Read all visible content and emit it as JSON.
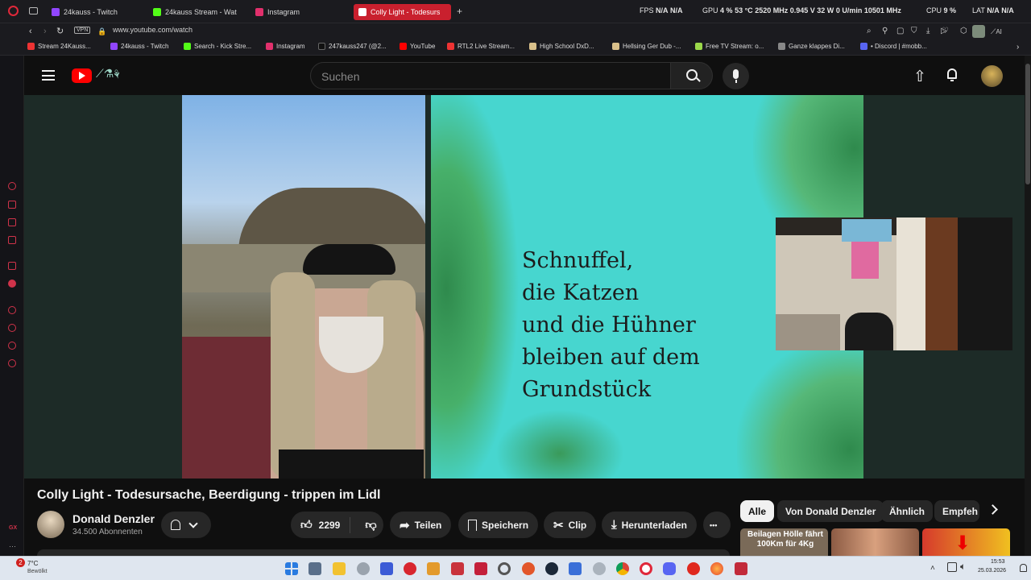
{
  "browser": {
    "tabs": [
      {
        "label": "24kauss - Twitch",
        "color": "#9146ff"
      },
      {
        "label": "24kauss Stream - Wat",
        "color": "#53fc18"
      },
      {
        "label": "Instagram",
        "color": "#e1306c"
      },
      {
        "label": "Colly Light - Todesurs",
        "color": "#ff0000",
        "active": true
      }
    ],
    "new_tab": "+",
    "stats": {
      "fps_label": "FPS",
      "fps": "N/A",
      "fps2": "N/A",
      "gpu_label": "GPU",
      "gpu_load": "4 %",
      "gpu_temp": "53 °C",
      "gpu_clock": "2520 MHz",
      "gpu_volt": "0.945 V",
      "gpu_power": "32 W",
      "gpu_fan": "0 U/min",
      "gpu_mem": "10501 MHz",
      "cpu_label": "CPU",
      "cpu_load": "9 %",
      "lat_label": "LAT",
      "lat": "N/A",
      "lat2": "N/A"
    },
    "url": "www.youtube.com/watch",
    "vpn": "VPN",
    "ai_label": "AI",
    "bookmarks": [
      {
        "label": "Stream 24Kauss...",
        "color": "#e33"
      },
      {
        "label": "24kauss - Twitch",
        "color": "#9146ff"
      },
      {
        "label": "Search - Kick Stre...",
        "color": "#53fc18"
      },
      {
        "label": "Instagram",
        "color": "#e1306c"
      },
      {
        "label": "247kauss247 (@2...",
        "color": "#111"
      },
      {
        "label": "YouTube",
        "color": "#ff0000"
      },
      {
        "label": "RTL2 Live Stream...",
        "color": "#e33"
      },
      {
        "label": "High School DxD...",
        "color": "#d9c08a"
      },
      {
        "label": "Hellsing Ger Dub -...",
        "color": "#d9c08a"
      },
      {
        "label": "Free TV Stream: o...",
        "color": "#9bd84a"
      },
      {
        "label": "Ganze klappes Di...",
        "color": "#888"
      },
      {
        "label": "• Discord | #mobb...",
        "color": "#5865f2"
      }
    ]
  },
  "youtube": {
    "search_placeholder": "Suchen",
    "video": {
      "slide_lines": [
        "Schnuffel,",
        "die Katzen",
        "und die Hühner",
        "bleiben auf dem",
        "Grundstück"
      ],
      "title": "Colly Light - Todesursache, Beerdigung - trippen im Lidl"
    },
    "channel": {
      "name": "Donald Denzler",
      "subscribers": "34.500 Abonnenten"
    },
    "actions": {
      "likes": "2299",
      "share": "Teilen",
      "save": "Speichern",
      "clip": "Clip",
      "download": "Herunterladen",
      "more": "•••"
    },
    "chips": [
      "Alle",
      "Von Donald Denzler",
      "Ähnlich",
      "Empfeh"
    ],
    "rec_thumb_text": "Beilagen Hölle fährt 100Km für 4Kg"
  },
  "taskbar": {
    "weather_temp": "7°C",
    "weather_desc": "Bewölkt",
    "notif_badge": "2",
    "time": "15:53",
    "date": "25.03.2026"
  }
}
